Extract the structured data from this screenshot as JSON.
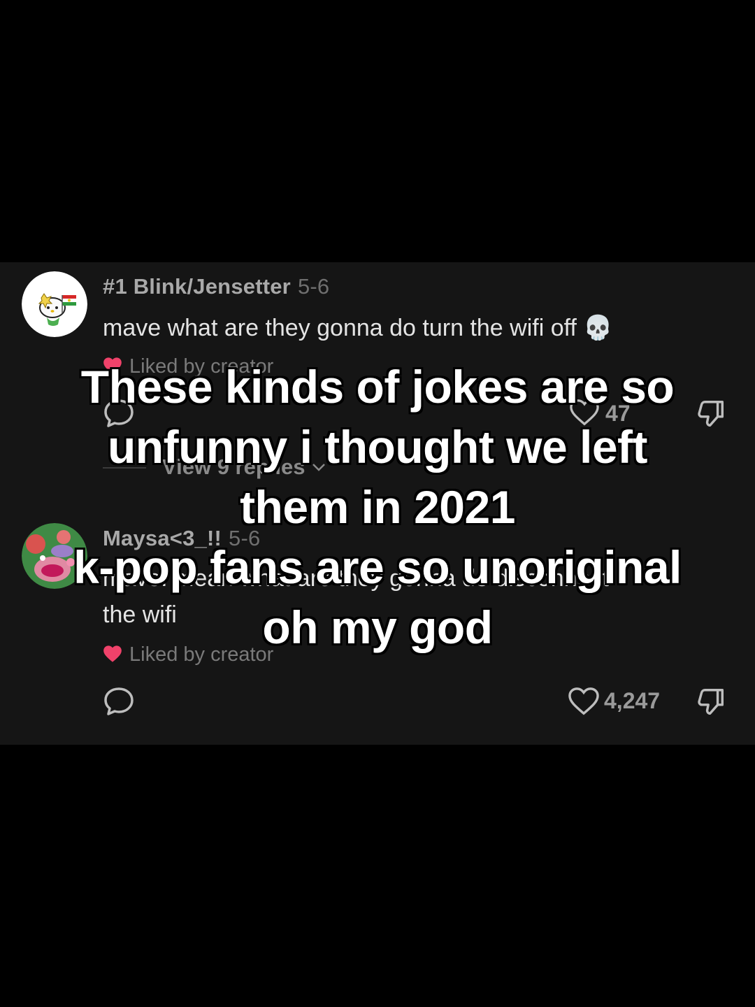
{
  "comments": [
    {
      "username": "#1 Blink/Jensetter",
      "date": "5-6",
      "text": "mave what are they gonna do turn the wifi off",
      "emoji": "💀",
      "liked_label": "Liked by creator",
      "view_replies": "View 9 replies",
      "likes": "47"
    },
    {
      "username": "Maysa<3_!!",
      "date": "5-6",
      "text_line1": "mave: mean what are they gonna do disconnect",
      "text_line2": "the wifi",
      "liked_label": "Liked by creator",
      "likes": "4,247"
    }
  ],
  "overlay": {
    "lines": [
      "These kinds of jokes are so",
      "unfunny i thought we left",
      "them in 2021",
      "k-pop fans are so unoriginal",
      "oh my god"
    ]
  },
  "icons": {
    "reply": "speech-bubble-icon",
    "like": "heart-outline-icon",
    "dislike": "thumbs-down-icon",
    "liked": "heart-filled-icon"
  },
  "colors": {
    "background": "#000000",
    "panel": "#151515",
    "liked_heart": "#f0426a"
  }
}
